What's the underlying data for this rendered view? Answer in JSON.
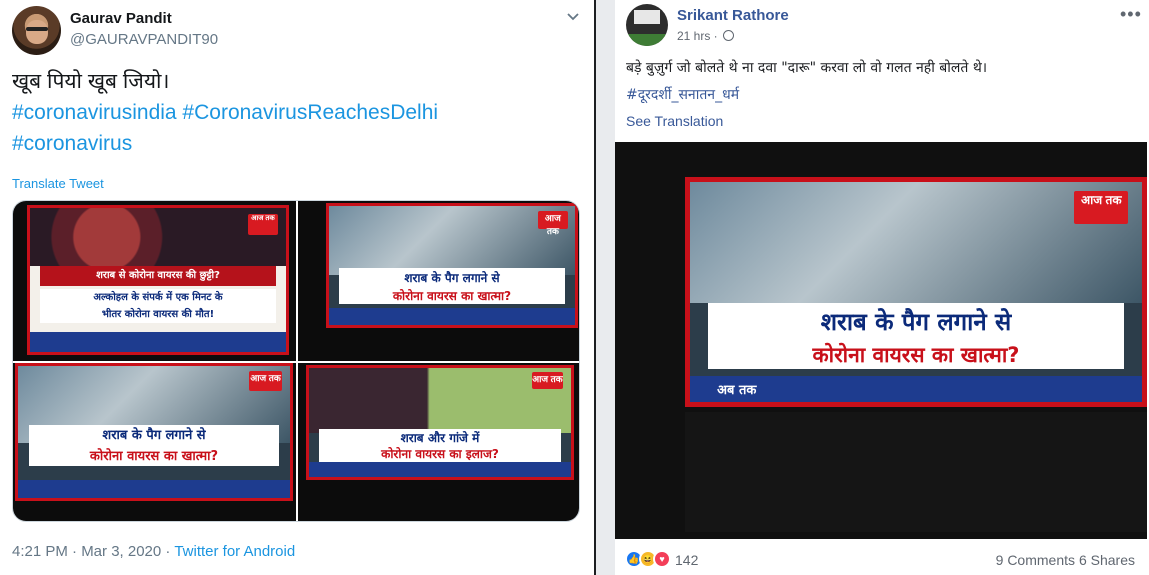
{
  "tweet": {
    "name": "Gaurav Pandit",
    "handle": "@GAURAVPANDIT90",
    "text_line": "खूब पियो खूब जियो।",
    "hashtags": [
      "#coronavirusindia #CoronavirusReachesDelhi",
      "#coronavirus"
    ],
    "translate": "Translate Tweet",
    "timestamp": "4:21 PM · Mar 3, 2020 · ",
    "source": "Twitter for Android",
    "images": [
      {
        "lines": [
          "शराब से कोरोना वायरस की छुट्टी?",
          "अल्कोहल के संपर्क में एक मिनट के",
          "भीतर कोरोना वायरस की मौत!"
        ]
      },
      {
        "lines": [
          "शराब के पैग लगाने से",
          "कोरोना वायरस का खात्मा?"
        ]
      },
      {
        "lines": [
          "शराब के पैग लगाने से",
          "कोरोना वायरस का खात्मा?"
        ]
      },
      {
        "lines": [
          "शराब और गांजे में",
          "कोरोना वायरस का इलाज?"
        ]
      }
    ]
  },
  "facebook": {
    "name": "Srikant Rathore",
    "time": "21 hrs · ",
    "text": "बड़े बुज़ुर्ग जो बोलते थे ना दवा \"दारू\" करवा लो वो गलत नही बोलते थे।",
    "hashtag": "#दूरदर्शी_सनातन_धर्म",
    "see_translation": "See Translation",
    "image": {
      "lines": [
        "शराब के पैग लगाने से",
        "कोरोना वायरस का खात्मा?"
      ],
      "ticker": "अब तक"
    },
    "reactions_count": "142",
    "comments": "9 Comments",
    "shares": "6 Shares"
  }
}
